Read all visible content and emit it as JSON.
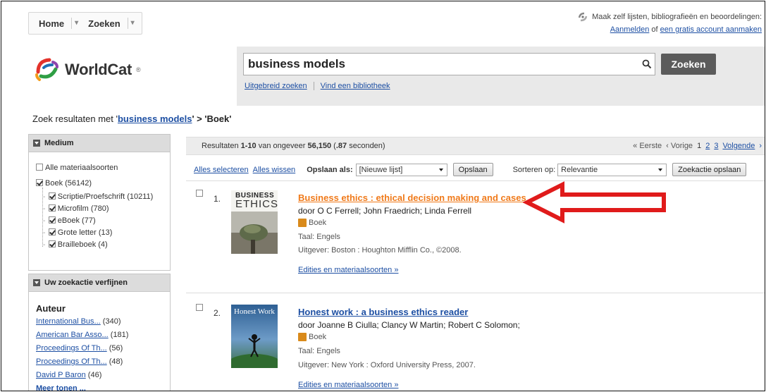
{
  "topnav": {
    "home": "Home",
    "search": "Zoeken"
  },
  "account": {
    "promo": "Maak zelf lijsten, bibliografieën en beoordelingen:",
    "login": "Aanmelden",
    "or": "of",
    "create": "een gratis account aanmaken"
  },
  "logo": {
    "name": "WorldCat",
    "reg": "®"
  },
  "search": {
    "query": "business models",
    "button": "Zoeken",
    "advanced": "Uitgebreid zoeken",
    "library": "Vind een bibliotheek"
  },
  "breadcrumb": {
    "prefix": "Zoek resultaten met '",
    "term": "business models",
    "suffix": "' > 'Boek'"
  },
  "medium_panel": {
    "title": "Medium",
    "all": "Alle materiaalsoorten",
    "book": "Boek (56142)",
    "subs": [
      "Scriptie/Proefschrift (10211)",
      "Microfilm (780)",
      "eBoek (77)",
      "Grote letter (13)",
      "Brailleboek (4)"
    ]
  },
  "refine_panel": {
    "title": "Uw zoekactie verfijnen",
    "author_heading": "Auteur",
    "authors": [
      {
        "name": "International Bus...",
        "count": "(340)"
      },
      {
        "name": "American Bar Asso...",
        "count": "(181)"
      },
      {
        "name": "Proceedings Of Th...",
        "count": "(56)"
      },
      {
        "name": "Proceedings Of Th...",
        "count": "(48)"
      },
      {
        "name": "David P Baron",
        "count": "(46)"
      }
    ],
    "more": "Meer tonen ..."
  },
  "results": {
    "summary_prefix": "Resultaten ",
    "range": "1-10",
    "of_about": " van ongeveer ",
    "total": "56,150",
    "time_prefix": " (",
    "time": ".87",
    "time_suffix": " seconden)",
    "pager": {
      "first": "« Eerste",
      "prev": "‹ Vorige",
      "current": "1",
      "page2": "2",
      "page3": "3",
      "next": "Volgende"
    },
    "select_all": "Alles selecteren",
    "clear_all": "Alles wissen",
    "save_as_label": "Opslaan als:",
    "save_as_value": "[Nieuwe lijst]",
    "save_button": "Opslaan",
    "sort_label": "Sorteren op:",
    "sort_value": "Relevantie",
    "save_search": "Zoekactie opslaan"
  },
  "records": [
    {
      "num": "1.",
      "title": "Business ethics : ethical decision making and cases",
      "authors": "door O C Ferrell; John Fraedrich; Linda Ferrell",
      "type": "Boek",
      "language": "Taal: Engels",
      "publisher": "Uitgever: Boston : Houghton Mifflin Co., ©2008.",
      "editions": "Edities en materiaalsoorten »",
      "cover_text_1": "BUSINESS",
      "cover_text_2": "ETHICS"
    },
    {
      "num": "2.",
      "title": "Honest work : a business ethics reader",
      "authors": "door Joanne B Ciulla; Clancy W Martin; Robert C Solomon;",
      "type": "Boek",
      "language": "Taal: Engels",
      "publisher": "Uitgever: New York : Oxford University Press, 2007.",
      "editions": "Edities en materiaalsoorten »",
      "cover_text_1": "Honest Work"
    }
  ],
  "colors": {
    "highlight_title": "#f07a1a",
    "arrow": "#e01b1b",
    "link": "#1d4fa3"
  }
}
